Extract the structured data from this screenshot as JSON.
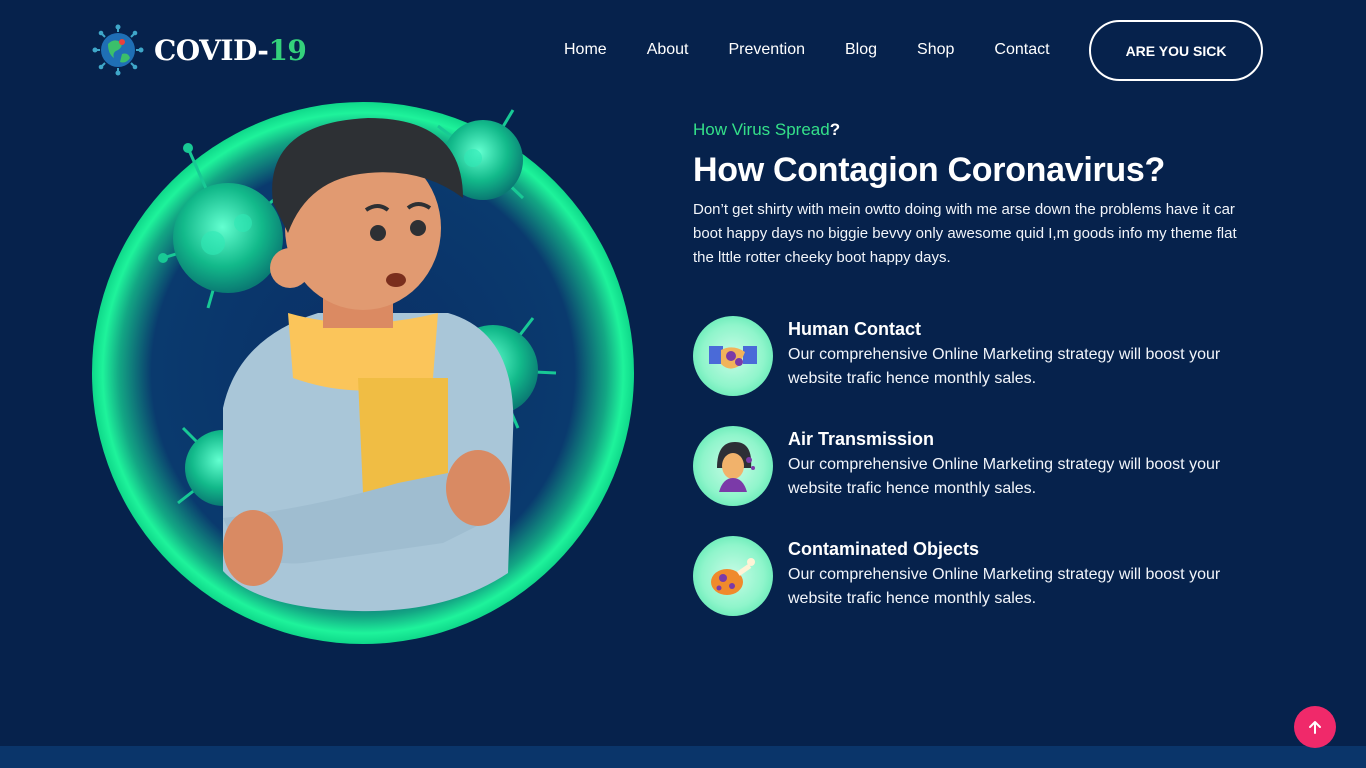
{
  "brand": {
    "name": "COVID-",
    "number": "19"
  },
  "nav": {
    "items": [
      {
        "label": "Home"
      },
      {
        "label": "About"
      },
      {
        "label": "Prevention"
      },
      {
        "label": "Blog"
      },
      {
        "label": "Shop"
      },
      {
        "label": "Contact"
      }
    ],
    "cta_label": "ARE YOU SICK"
  },
  "section": {
    "eyebrow": "How Virus Spread",
    "eyebrow_mark": "?",
    "heading": "How Contagion Coronavirus",
    "heading_mark": "?",
    "lead": "Don’t get shirty with mein owtto doing with me arse down the problems have it car boot happy days no biggie bevvy only awesome quid I,m goods info my theme flat the lttle rotter cheeky boot happy days.",
    "features": [
      {
        "icon": "handshake-icon",
        "title": "Human Contact",
        "description": "Our comprehensive Online Marketing strategy will boost your website trafic hence monthly sales."
      },
      {
        "icon": "sneezing-person-icon",
        "title": "Air Transmission",
        "description": "Our comprehensive Online Marketing strategy will boost your website trafic hence monthly sales."
      },
      {
        "icon": "contaminated-food-icon",
        "title": "Contaminated Objects",
        "description": "Our comprehensive Online Marketing strategy will boost your website trafic hence monthly sales."
      }
    ]
  },
  "colors": {
    "background": "#06224c",
    "accent": "#34e089",
    "button_top": "#f0296a"
  }
}
